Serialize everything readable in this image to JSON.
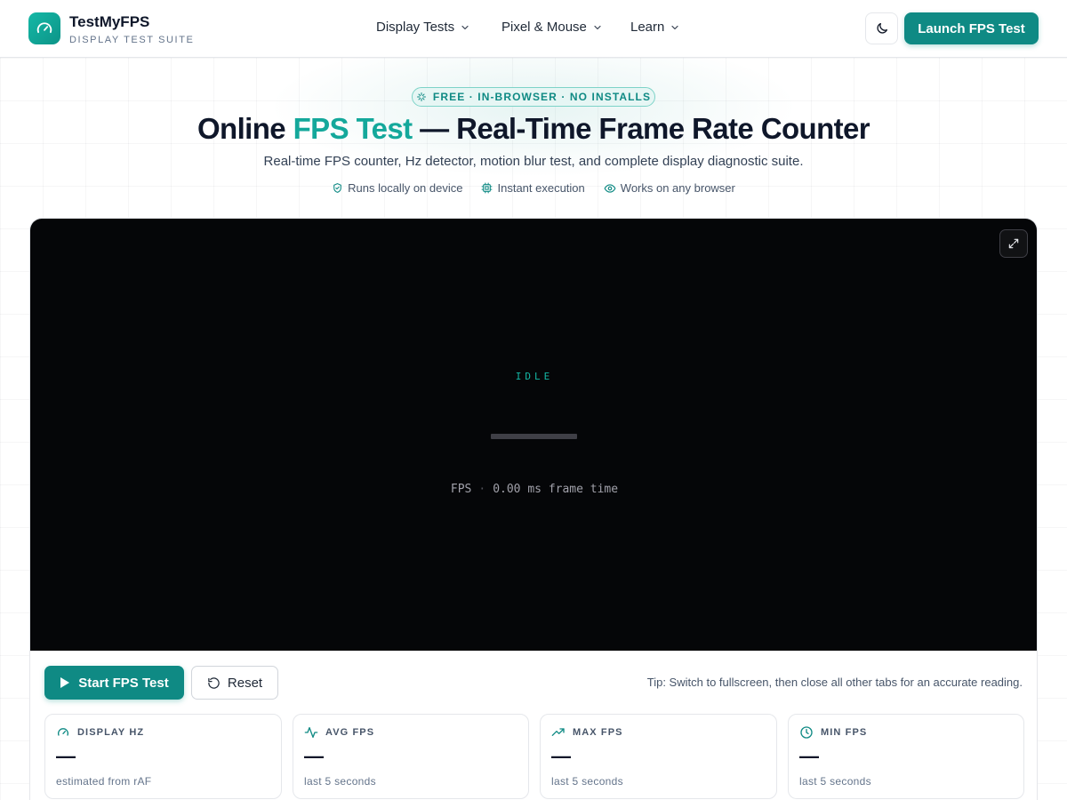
{
  "header": {
    "brand_name": "TestMyFPS",
    "brand_tagline": "DISPLAY TEST SUITE",
    "nav": [
      {
        "label": "Display Tests"
      },
      {
        "label": "Pixel & Mouse"
      },
      {
        "label": "Learn"
      }
    ],
    "launch_label": "Launch FPS Test"
  },
  "hero": {
    "pill": "FREE · IN-BROWSER · NO INSTALLS",
    "title_pre": "Online ",
    "title_accent": "FPS Test",
    "title_post": " — Real-Time Frame Rate Counter",
    "subtitle": "Real-time FPS counter, Hz detector, motion blur test, and complete display diagnostic suite.",
    "badges": [
      {
        "label": "Runs locally on device",
        "icon": "shield-check-icon"
      },
      {
        "label": "Instant execution",
        "icon": "chip-icon"
      },
      {
        "label": "Works on any browser",
        "icon": "eye-icon"
      }
    ]
  },
  "test": {
    "status": "IDLE",
    "fps_label": "FPS",
    "separator": "·",
    "frame_time": "0.00 ms frame time",
    "start_label": "Start FPS Test",
    "reset_label": "Reset",
    "tip": "Tip: Switch to fullscreen, then close all other tabs for an accurate reading."
  },
  "stats": [
    {
      "title": "DISPLAY HZ",
      "value": "—",
      "caption": "estimated from rAF",
      "icon": "gauge-icon"
    },
    {
      "title": "AVG FPS",
      "value": "—",
      "caption": "last 5 seconds",
      "icon": "activity-icon"
    },
    {
      "title": "MAX FPS",
      "value": "—",
      "caption": "last 5 seconds",
      "icon": "trending-up-icon"
    },
    {
      "title": "MIN FPS",
      "value": "—",
      "caption": "last 5 seconds",
      "icon": "clock-icon"
    }
  ],
  "colors": {
    "accent": "#0f8a84",
    "accent_light": "#14b8a6",
    "screen_bg": "#050608"
  }
}
